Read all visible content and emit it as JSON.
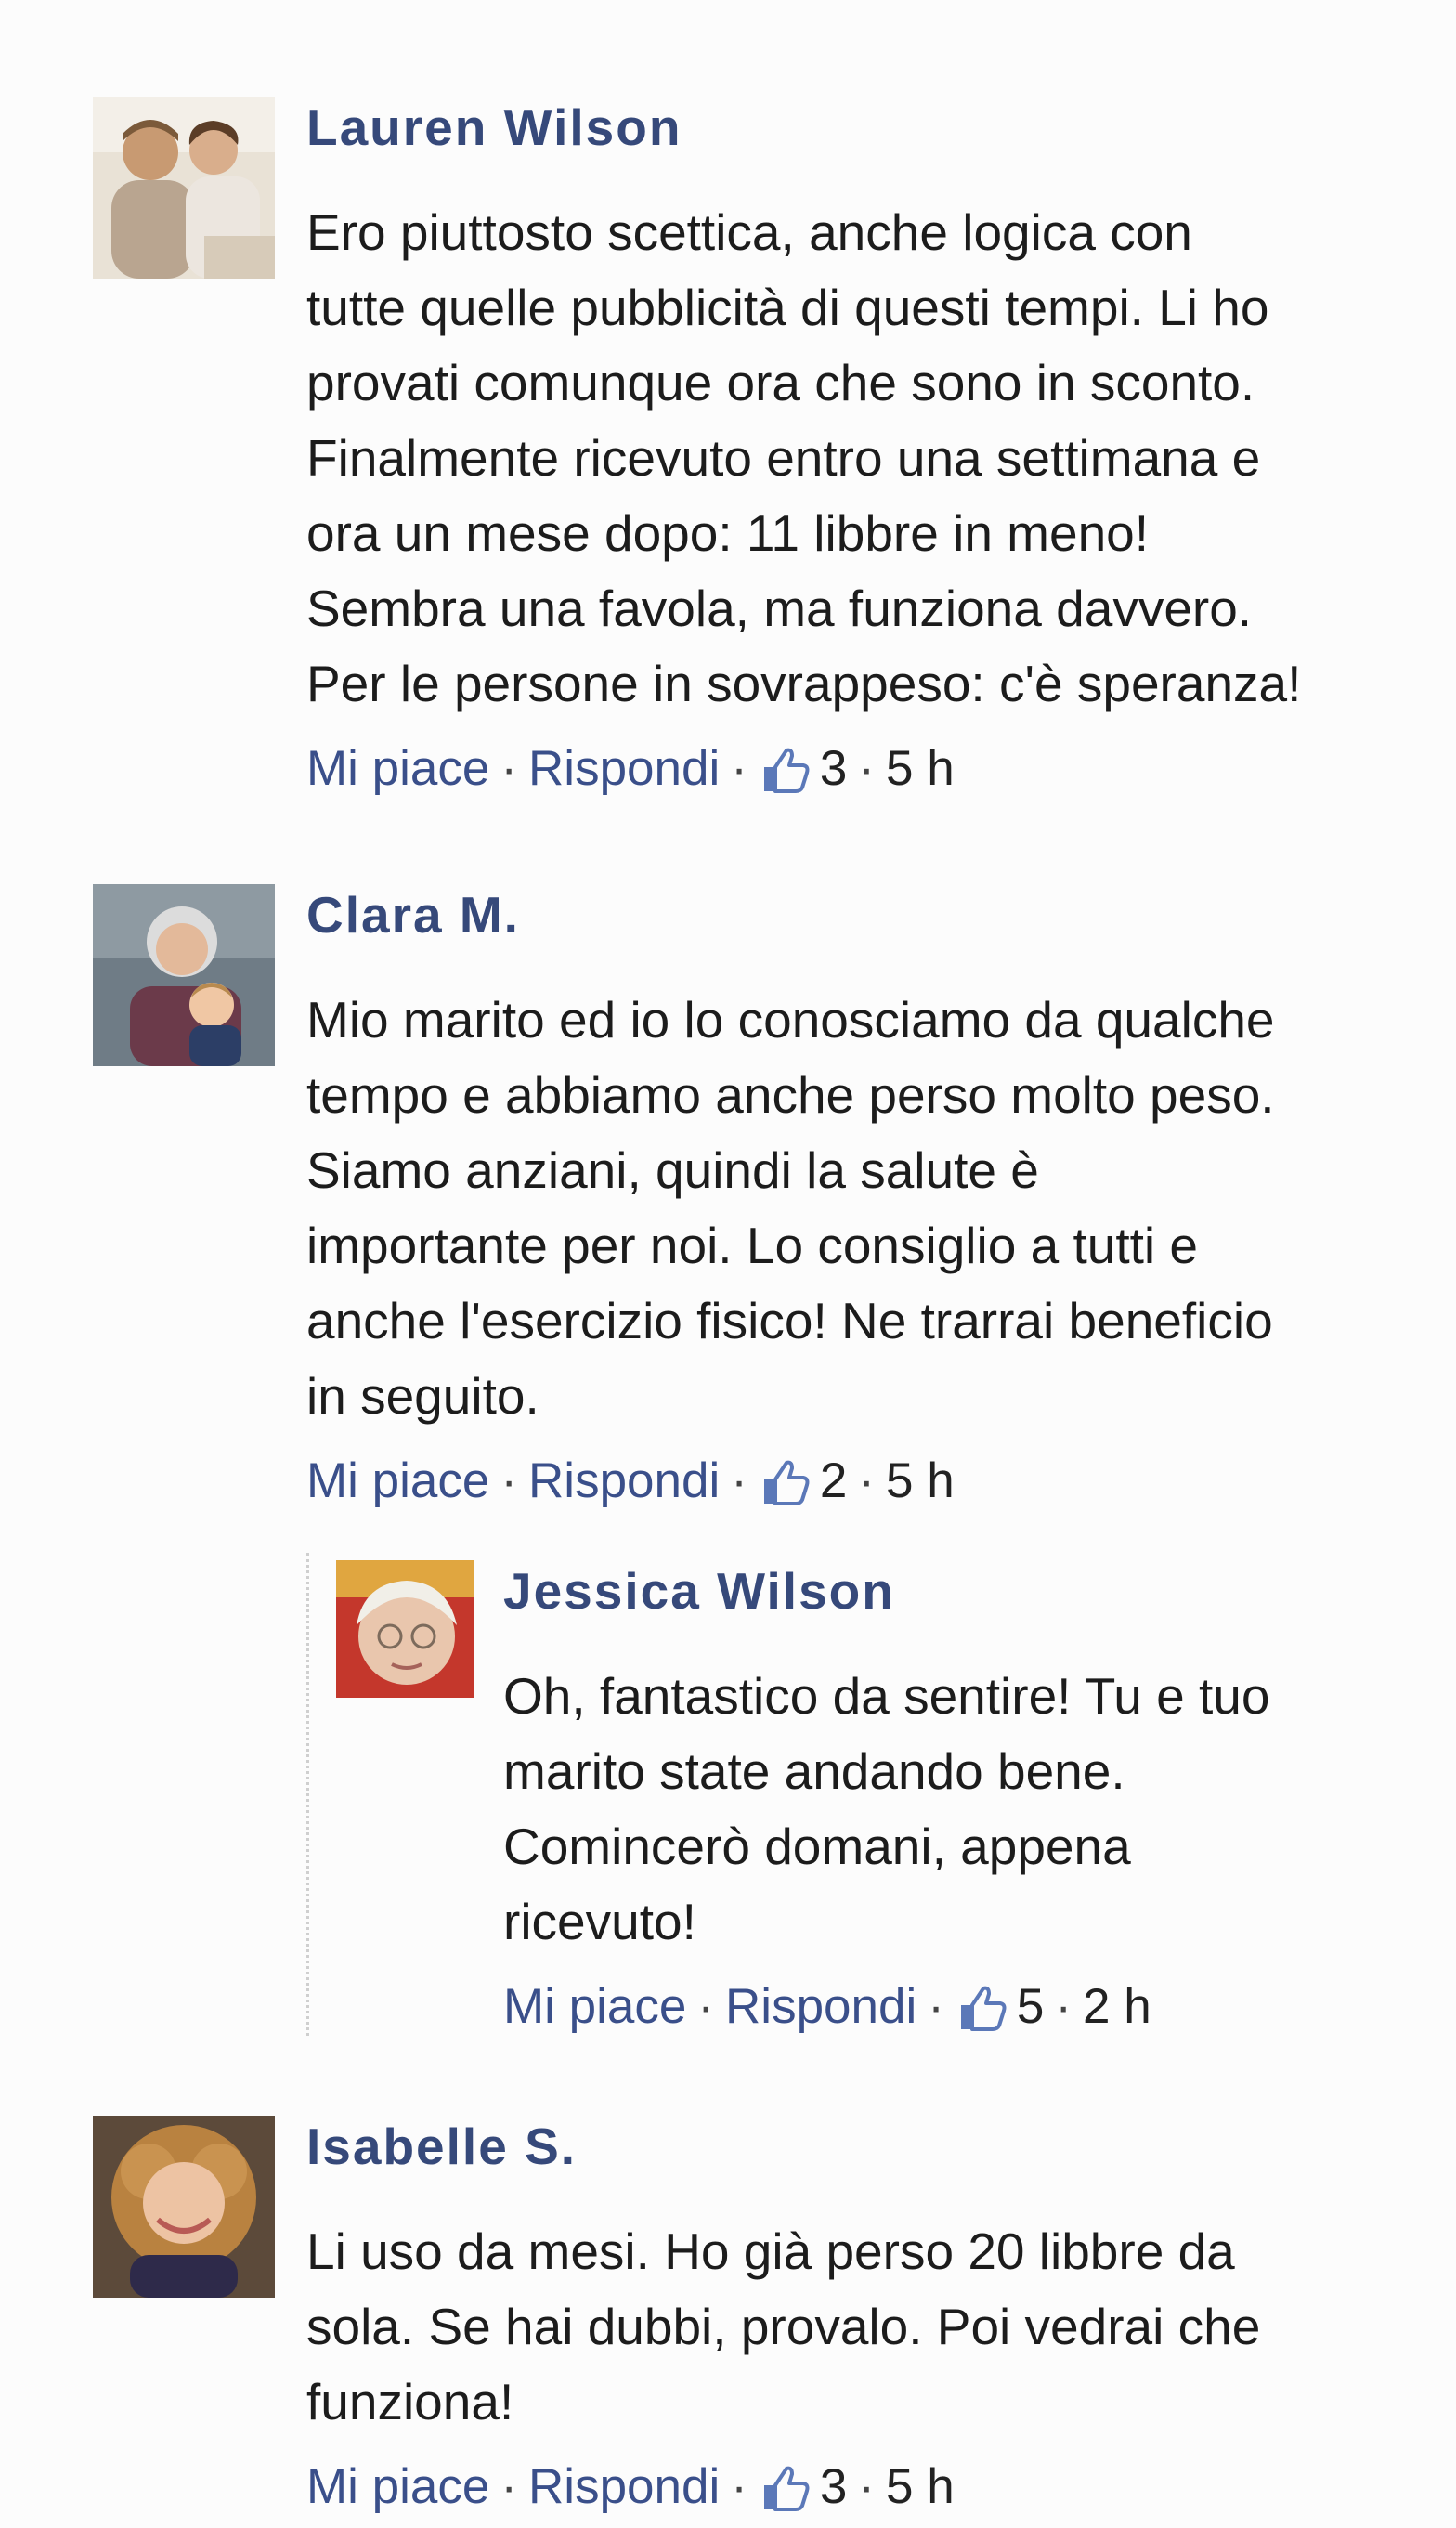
{
  "comments": [
    {
      "author": "Lauren Wilson",
      "lines": [
        "Ero piuttosto scettica, anche logica con",
        "tutte quelle pubblicità di questi tempi. Li ho",
        "provati comunque ora che sono in sconto.",
        "Finalmente ricevuto entro una settimana e",
        "ora un mese dopo: 11 libbre in meno!",
        "Sembra una favola, ma funziona davvero.",
        "Per le persone in sovrappeso: c'è speranza!"
      ],
      "like_label": "Mi piace",
      "reply_label": "Rispondi",
      "likes": "3",
      "time": "5 h"
    },
    {
      "author": "Clara M.",
      "lines": [
        "Mio marito ed io lo conosciamo da qualche",
        "tempo e abbiamo anche perso molto peso.",
        "Siamo anziani, quindi la salute è",
        "importante per noi. Lo consiglio a tutti e",
        "anche l'esercizio fisico! Ne trarrai beneficio",
        "in seguito."
      ],
      "like_label": "Mi piace",
      "reply_label": "Rispondi",
      "likes": "2",
      "time": "5 h",
      "reply": {
        "author": "Jessica Wilson",
        "lines": [
          "Oh, fantastico da sentire! Tu e tuo",
          "marito state andando bene.",
          "Comincerò domani, appena",
          "ricevuto!"
        ],
        "like_label": "Mi piace",
        "reply_label": "Rispondi",
        "likes": "5",
        "time": "2 h"
      }
    },
    {
      "author": "Isabelle S.",
      "lines": [
        "Li uso da mesi. Ho già perso 20 libbre da",
        "sola. Se hai dubbi, provalo. Poi vedrai che",
        "funziona!"
      ],
      "like_label": "Mi piace",
      "reply_label": "Rispondi",
      "likes": "3",
      "time": "5 h"
    }
  ],
  "separator": "·",
  "icons": {
    "like": "thumbs-up-icon"
  },
  "colors": {
    "author": "#36497a",
    "link": "#3a4f8a",
    "text": "#1c1c1c",
    "thumb": "#5b78b8"
  }
}
